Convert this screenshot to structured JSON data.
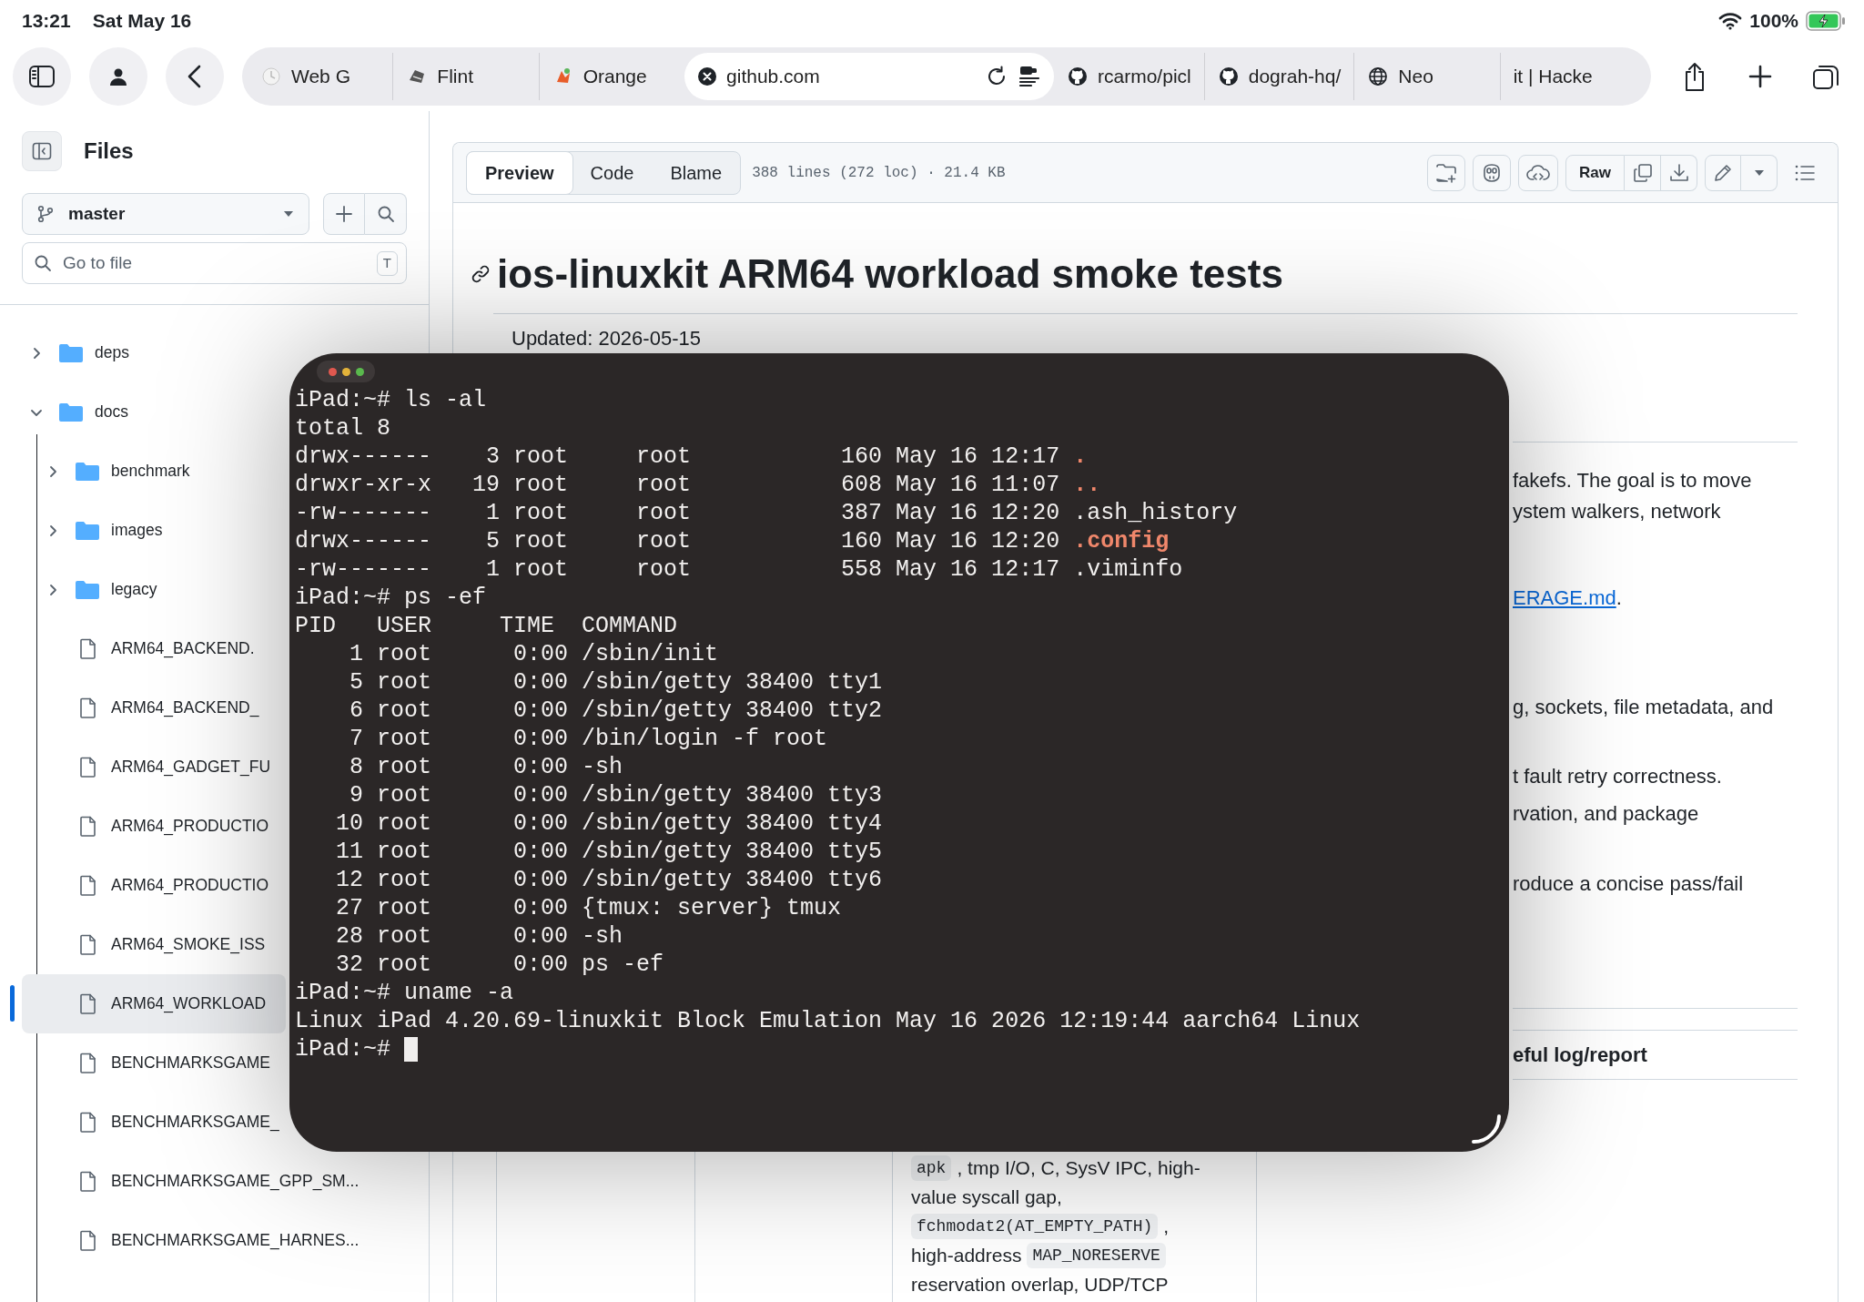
{
  "status_bar": {
    "time": "13:21",
    "date": "Sat May 16",
    "battery": "100%",
    "charging": true
  },
  "browser_tabs": [
    {
      "title": "Web G",
      "selected": false
    },
    {
      "title": "Flint",
      "selected": false
    },
    {
      "title": "Orange",
      "selected": false
    },
    {
      "title": "github.com",
      "selected": true
    },
    {
      "title": "rcarmo/picl",
      "selected": false
    },
    {
      "title": "dograh-hq/",
      "selected": false
    },
    {
      "title": "Neo",
      "selected": false
    },
    {
      "title": "it | Hacke",
      "selected": false
    }
  ],
  "sidebar": {
    "title": "Files",
    "branch": "master",
    "search": {
      "placeholder": "Go to file",
      "shortcut": "T"
    },
    "tree": [
      {
        "name": "deps",
        "kind": "folder",
        "expanded": false,
        "selected": false
      },
      {
        "name": "docs",
        "kind": "folder",
        "expanded": true,
        "selected": false,
        "children": [
          {
            "name": "benchmark",
            "kind": "folder",
            "expanded": false,
            "selected": false
          },
          {
            "name": "images",
            "kind": "folder",
            "expanded": false,
            "selected": false
          },
          {
            "name": "legacy",
            "kind": "folder",
            "expanded": false,
            "selected": false
          },
          {
            "name": "ARM64_BACKEND.",
            "kind": "file",
            "selected": false
          },
          {
            "name": "ARM64_BACKEND_",
            "kind": "file",
            "selected": false
          },
          {
            "name": "ARM64_GADGET_FU",
            "kind": "file",
            "selected": false
          },
          {
            "name": "ARM64_PRODUCTIO",
            "kind": "file",
            "selected": false
          },
          {
            "name": "ARM64_PRODUCTIO",
            "kind": "file",
            "selected": false
          },
          {
            "name": "ARM64_SMOKE_ISS",
            "kind": "file",
            "selected": false
          },
          {
            "name": "ARM64_WORKLOAD",
            "kind": "file",
            "selected": true
          },
          {
            "name": "BENCHMARKSGAME",
            "kind": "file",
            "selected": false
          },
          {
            "name": "BENCHMARKSGAME_",
            "kind": "file",
            "selected": false
          },
          {
            "name": "BENCHMARKSGAME_GPP_SM...",
            "kind": "file",
            "selected": false
          },
          {
            "name": "BENCHMARKSGAME_HARNES...",
            "kind": "file",
            "selected": false
          }
        ]
      }
    ]
  },
  "file_view": {
    "tabs": [
      {
        "label": "Preview",
        "selected": true
      },
      {
        "label": "Code",
        "selected": false
      },
      {
        "label": "Blame",
        "selected": false
      }
    ],
    "file_info": "388 lines (272 loc) · 21.4 KB",
    "raw_button": "Raw",
    "heading": "ios-linuxkit ARM64 workload smoke tests",
    "updated": "Updated: 2026-05-15",
    "fragments": [
      {
        "kind": "text",
        "text": "fakefs. The goal is to move"
      },
      {
        "kind": "text",
        "text": "ystem walkers, network"
      },
      {
        "kind": "link",
        "text": "ERAGE.md",
        "after": "."
      },
      {
        "kind": "text",
        "text": "g, sockets, file metadata, and"
      },
      {
        "kind": "text",
        "text": "t fault retry correctness."
      },
      {
        "kind": "text",
        "text": "rvation, and package"
      },
      {
        "kind": "text",
        "text": "roduce a concise pass/fail"
      },
      {
        "kind": "heading",
        "text": "eful log/report"
      }
    ],
    "table_cell": [
      {
        "segments": [
          {
            "kind": "code",
            "text": "apk"
          },
          {
            "kind": "text",
            "text": ", tmp I/O, C, SysV IPC, high-"
          }
        ]
      },
      {
        "segments": [
          {
            "kind": "text",
            "text": "value syscall gap,"
          }
        ]
      },
      {
        "segments": [
          {
            "kind": "code",
            "text": "fchmodat2(AT_EMPTY_PATH)"
          },
          {
            "kind": "text",
            "text": ","
          }
        ]
      },
      {
        "segments": [
          {
            "kind": "text",
            "text": "high-address"
          },
          {
            "kind": "code",
            "text": "MAP_NORESERVE"
          }
        ]
      },
      {
        "segments": [
          {
            "kind": "text",
            "text": "reservation overlap, UDP/TCP"
          }
        ]
      }
    ]
  },
  "terminal": {
    "lines": [
      {
        "text": "iPad:~# ls -al"
      },
      {
        "text": "total 8"
      },
      {
        "text": "drwx------    3 root     root           160 May 16 12:17",
        "name": ".",
        "kind": "dir"
      },
      {
        "text": "drwxr-xr-x   19 root     root           608 May 16 11:07",
        "name": "..",
        "kind": "dir"
      },
      {
        "text": "-rw-------    1 root     root           387 May 16 12:20",
        "name": ".ash_history",
        "kind": "file"
      },
      {
        "text": "drwx------    5 root     root           160 May 16 12:20",
        "name": ".config",
        "kind": "dir"
      },
      {
        "text": "-rw-------    1 root     root           558 May 16 12:17",
        "name": ".viminfo",
        "kind": "file"
      },
      {
        "text": "iPad:~# ps -ef"
      },
      {
        "text": "PID   USER     TIME  COMMAND"
      },
      {
        "text": "    1 root      0:00 /sbin/init"
      },
      {
        "text": "    5 root      0:00 /sbin/getty 38400 tty1"
      },
      {
        "text": "    6 root      0:00 /sbin/getty 38400 tty2"
      },
      {
        "text": "    7 root      0:00 /bin/login -f root"
      },
      {
        "text": "    8 root      0:00 -sh"
      },
      {
        "text": "    9 root      0:00 /sbin/getty 38400 tty3"
      },
      {
        "text": "   10 root      0:00 /sbin/getty 38400 tty4"
      },
      {
        "text": "   11 root      0:00 /sbin/getty 38400 tty5"
      },
      {
        "text": "   12 root      0:00 /sbin/getty 38400 tty6"
      },
      {
        "text": "   27 root      0:00 {tmux: server} tmux"
      },
      {
        "text": "   28 root      0:00 -sh"
      },
      {
        "text": "   32 root      0:00 ps -ef"
      },
      {
        "text": "iPad:~# uname -a"
      },
      {
        "text": "Linux iPad 4.20.69-linuxkit Block Emulation May 16 2026 12:19:44 aarch64 Linux"
      },
      {
        "text": "iPad:~#",
        "cursor": true
      }
    ]
  }
}
